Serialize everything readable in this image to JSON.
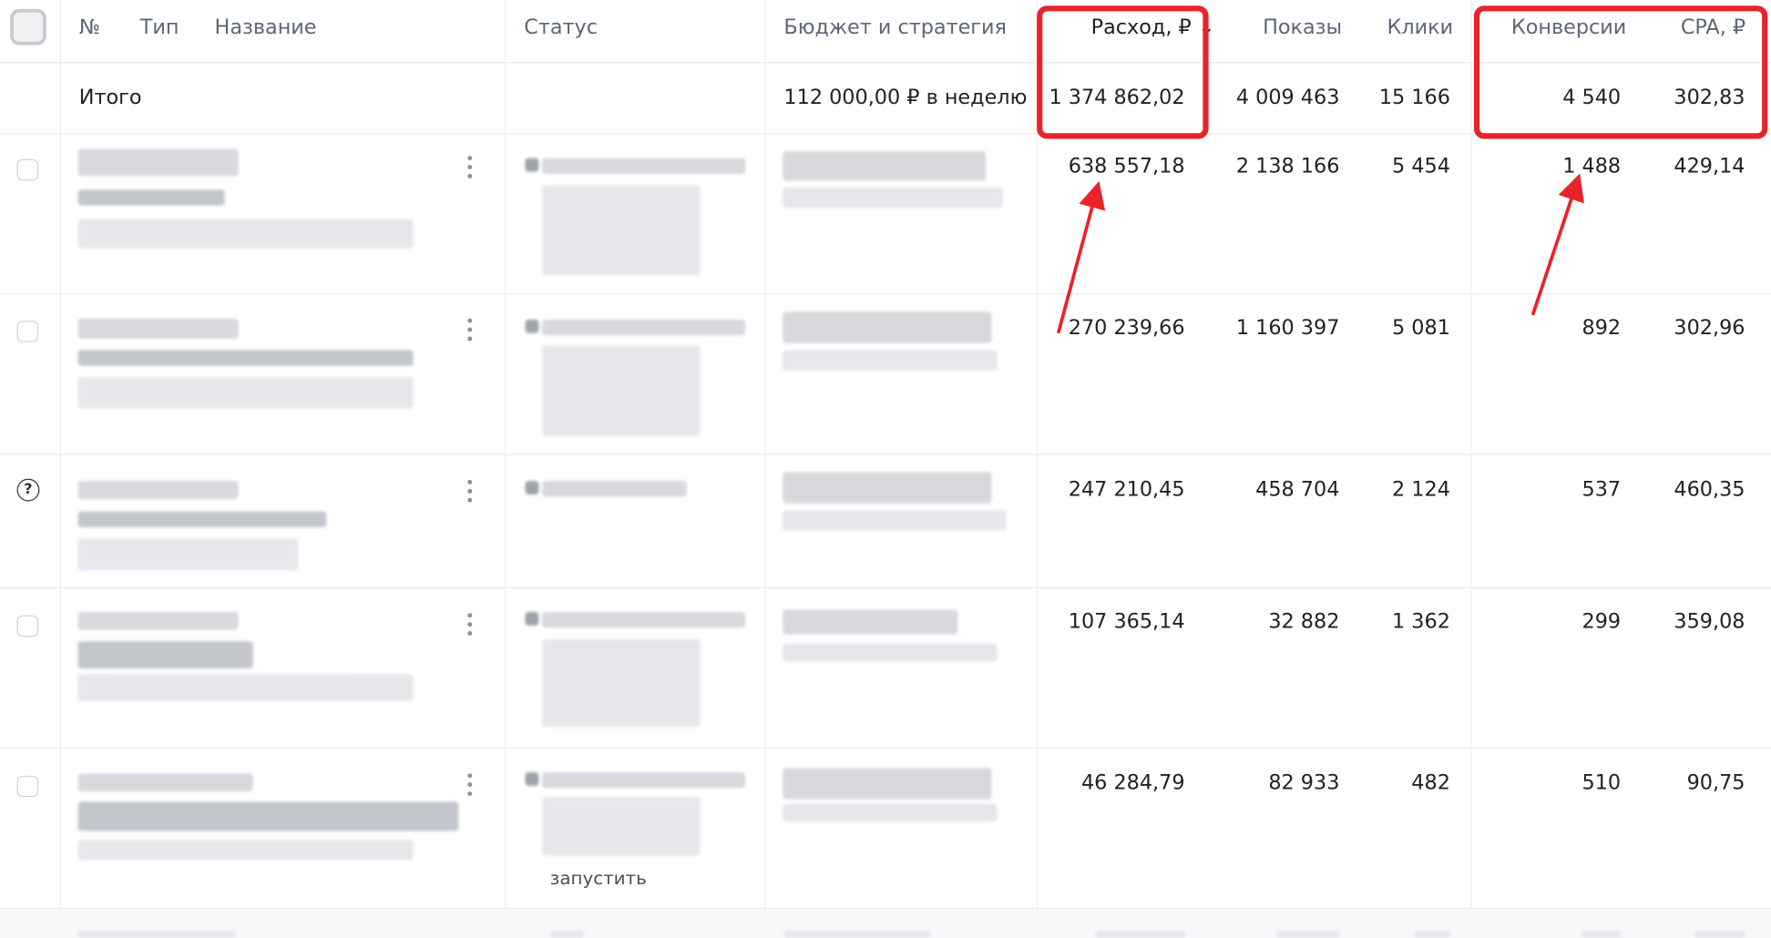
{
  "header": {
    "num": "№",
    "type": "Тип",
    "name": "Название",
    "status": "Статус",
    "budget": "Бюджет и стратегия",
    "spend": "Расход, ₽ ↓",
    "impressions": "Показы",
    "clicks": "Клики",
    "conversions": "Конверсии",
    "cpa": "CPA, ₽"
  },
  "totals": {
    "label": "Итого",
    "budget": "112 000,00 ₽ в неделю",
    "spend": "1 374 862,02",
    "impressions": "4 009 463",
    "clicks": "15 166",
    "conversions": "4 540",
    "cpa": "302,83"
  },
  "rows": [
    {
      "spend": "638 557,18",
      "impressions": "2 138 166",
      "clicks": "5 454",
      "conversions": "1 488",
      "cpa": "429,14"
    },
    {
      "spend": "270 239,66",
      "impressions": "1 160 397",
      "clicks": "5 081",
      "conversions": "892",
      "cpa": "302,96"
    },
    {
      "spend": "247 210,45",
      "impressions": "458 704",
      "clicks": "2 124",
      "conversions": "537",
      "cpa": "460,35"
    },
    {
      "spend": "107 365,14",
      "impressions": "32 882",
      "clicks": "1 362",
      "conversions": "299",
      "cpa": "359,08"
    },
    {
      "spend": "46 284,79",
      "impressions": "82 933",
      "clicks": "482",
      "conversions": "510",
      "cpa": "90,75"
    }
  ],
  "row5_status_link": "запустить",
  "icons": {
    "row_menu": "kebab-icon",
    "help": "question-circle-icon"
  },
  "colors": {
    "highlight": "#e8232a",
    "header_text": "#5d6676"
  }
}
